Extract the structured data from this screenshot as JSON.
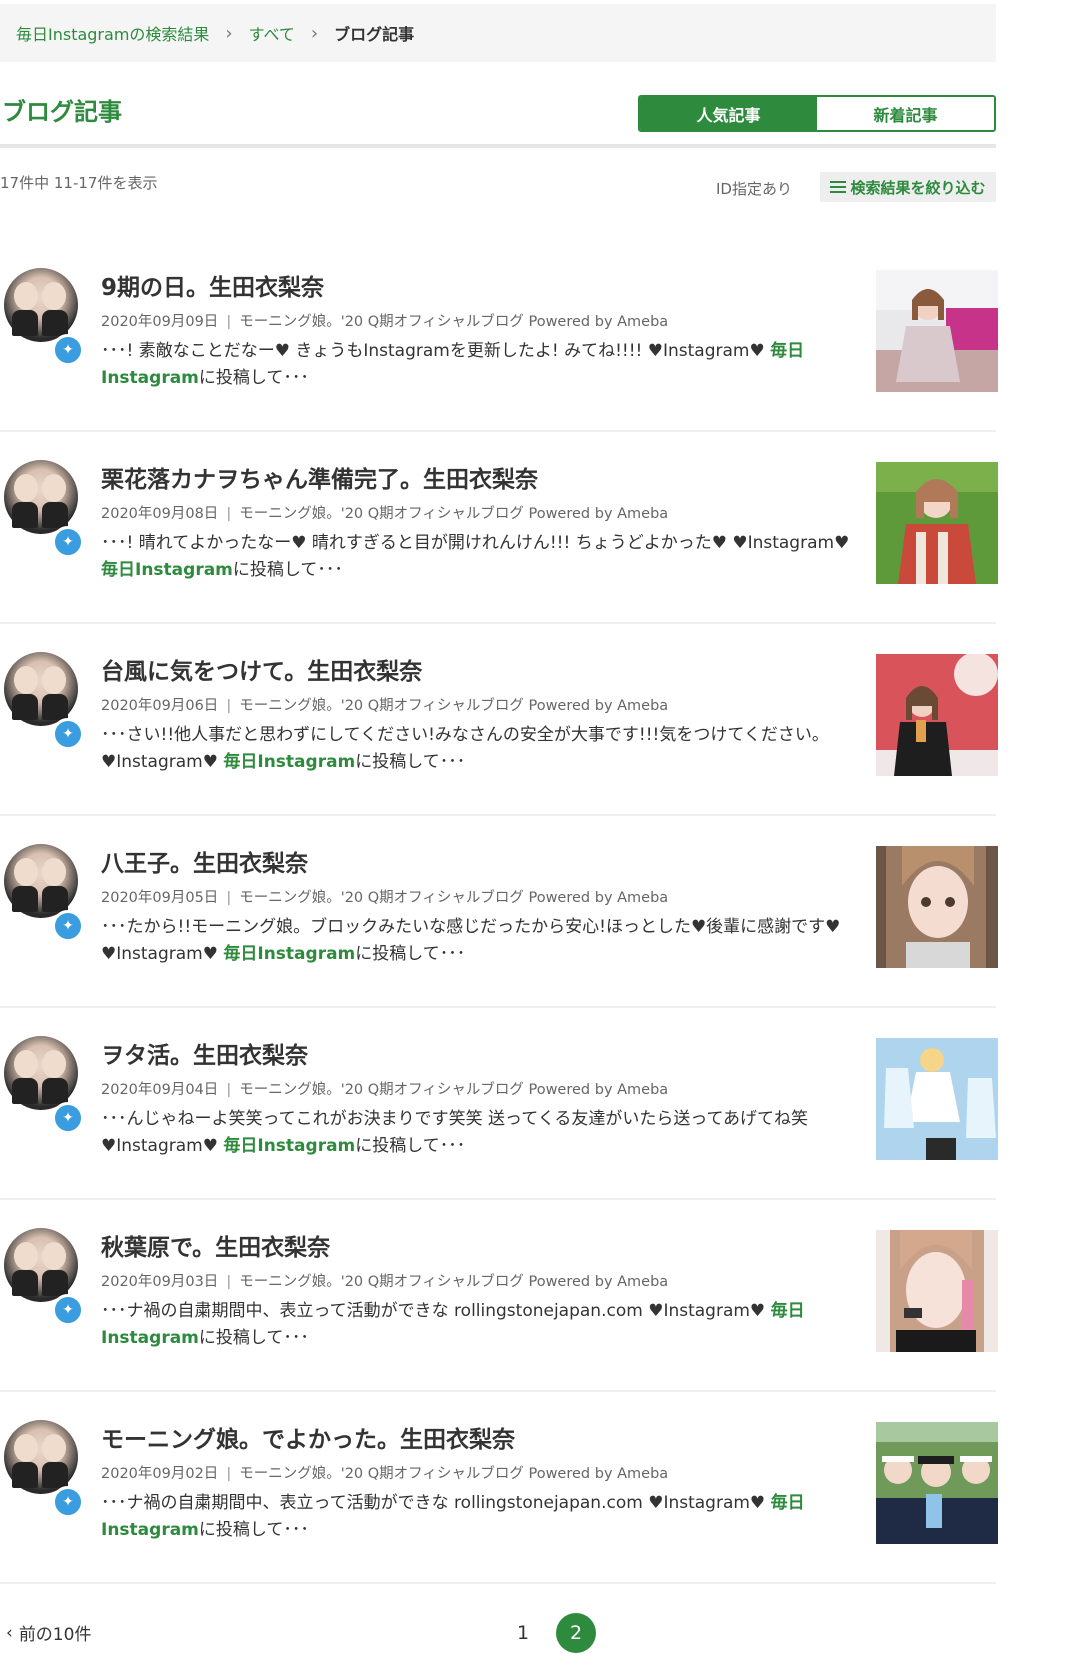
{
  "breadcrumb": {
    "items": [
      "毎日Instagramの検索結果",
      "すべて"
    ],
    "current": "ブログ記事",
    "separator": "›"
  },
  "page_title": "ブログ記事",
  "tabs": [
    {
      "label": "人気記事",
      "active": true
    },
    {
      "label": "新着記事",
      "active": false
    }
  ],
  "result_count": "17件中 11-17件を表示",
  "id_filter": "ID指定あり",
  "refine_button": "検索結果を絞り込む",
  "colors": {
    "accent": "#2e8b3e",
    "badge": "#3a9de0"
  },
  "posts": [
    {
      "title": "9期の日。生田衣梨奈",
      "date": "2020年09月09日",
      "source": "モーニング娘。'20 Q期オフィシャルブログ Powered by Ameba",
      "snippet_pre": "･･･! 素敵なことだなー♥ きょうもInstagramを更新したよ! みてね!!!! ♥Instagram♥ ",
      "snippet_hl": "毎日Instagram",
      "snippet_post": "に投稿して･･･"
    },
    {
      "title": "栗花落カナヲちゃん準備完了。生田衣梨奈",
      "date": "2020年09月08日",
      "source": "モーニング娘。'20 Q期オフィシャルブログ Powered by Ameba",
      "snippet_pre": "･･･! 晴れてよかったなー♥ 晴れすぎると目が開けれんけん!!! ちょうどよかった♥ ♥Instagram♥ ",
      "snippet_hl": "毎日Instagram",
      "snippet_post": "に投稿して･･･"
    },
    {
      "title": "台風に気をつけて。生田衣梨奈",
      "date": "2020年09月06日",
      "source": "モーニング娘。'20 Q期オフィシャルブログ Powered by Ameba",
      "snippet_pre": "･･･さい!!他人事だと思わずにしてください!みなさんの安全が大事です!!!気をつけてください。 ♥Instagram♥ ",
      "snippet_hl": "毎日Instagram",
      "snippet_post": "に投稿して･･･"
    },
    {
      "title": "八王子。生田衣梨奈",
      "date": "2020年09月05日",
      "source": "モーニング娘。'20 Q期オフィシャルブログ Powered by Ameba",
      "snippet_pre": "･･･たから!!モーニング娘。ブロックみたいな感じだったから安心!ほっとした♥後輩に感謝です♥ ♥Instagram♥ ",
      "snippet_hl": "毎日Instagram",
      "snippet_post": "に投稿して･･･"
    },
    {
      "title": "ヲタ活。生田衣梨奈",
      "date": "2020年09月04日",
      "source": "モーニング娘。'20 Q期オフィシャルブログ Powered by Ameba",
      "snippet_pre": "･･･んじゃねーよ笑笑ってこれがお決まりです笑笑 送ってくる友達がいたら送ってあげてね笑 ♥Instagram♥ ",
      "snippet_hl": "毎日Instagram",
      "snippet_post": "に投稿して･･･"
    },
    {
      "title": "秋葉原で。生田衣梨奈",
      "date": "2020年09月03日",
      "source": "モーニング娘。'20 Q期オフィシャルブログ Powered by Ameba",
      "snippet_pre": "･･･ナ禍の自粛期間中、表立って活動ができな rollingstonejapan.com ♥Instagram♥ ",
      "snippet_hl": "毎日Instagram",
      "snippet_post": "に投稿して･･･"
    },
    {
      "title": "モーニング娘。でよかった。生田衣梨奈",
      "date": "2020年09月02日",
      "source": "モーニング娘。'20 Q期オフィシャルブログ Powered by Ameba",
      "snippet_pre": "･･･ナ禍の自粛期間中、表立って活動ができな rollingstonejapan.com ♥Instagram♥ ",
      "snippet_hl": "毎日Instagram",
      "snippet_post": "に投稿して･･･"
    }
  ],
  "pagination": {
    "prev_label": "前の10件",
    "pages": [
      "1"
    ],
    "current": "2"
  }
}
